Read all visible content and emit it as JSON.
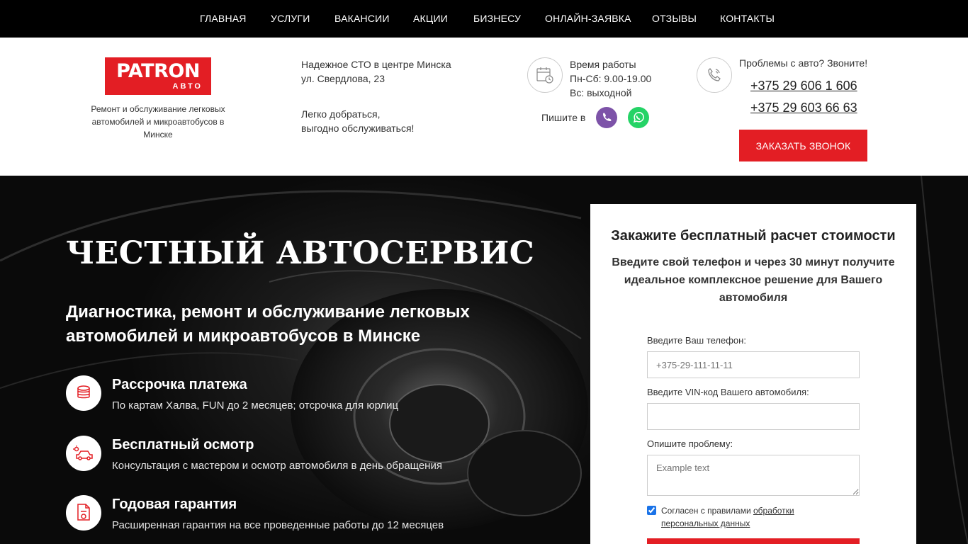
{
  "nav": {
    "items": [
      "ГЛАВНАЯ",
      "УСЛУГИ",
      "ВАКАНСИИ",
      "АКЦИИ",
      "БИЗНЕСУ",
      "ОНЛАЙН-ЗАЯВКА",
      "ОТЗЫВЫ",
      "КОНТАКТЫ"
    ]
  },
  "header": {
    "logo_top": "PATRON",
    "logo_bottom": "АВТО",
    "logo_desc": "Ремонт и обслуживание легковых автомобилей и микроавтобусов в Минске",
    "address_line1": "Надежное СТО в центре Минска",
    "address_line2": "ул. Свердлова, 23",
    "easy_line1": "Легко добраться,",
    "easy_line2": "выгодно обслуживаться!",
    "hours_title": "Время работы",
    "hours_weekdays": "Пн-Сб: 9.00-19.00",
    "hours_sunday": "Вс: выходной",
    "write_label": "Пишите в",
    "call_prompt": "Проблемы с авто? Звоните!",
    "phone1": "+375 29 606 1 606",
    "phone2": "+375 29 603 66 63",
    "callback_button": "ЗАКАЗАТЬ ЗВОНОК"
  },
  "hero": {
    "title": "ЧЕСТНЫЙ АВТОСЕРВИС",
    "subtitle": "Диагностика, ремонт и обслуживание легковых автомобилей и микроавтобусов в Минске",
    "features": [
      {
        "icon": "coins-icon",
        "title": "Рассрочка платежа",
        "desc": "По картам Халва, FUN до 2 месяцев; отсрочка для юрлиц"
      },
      {
        "icon": "car-inspection-icon",
        "title": "Бесплатный осмотр",
        "desc": "Консультация с мастером и осмотр автомобиля в день обращения"
      },
      {
        "icon": "warranty-document-icon",
        "title": "Годовая гарантия",
        "desc": "Расширенная гарантия на все проведенные работы до 12 месяцев"
      }
    ]
  },
  "form": {
    "title": "Закажите бесплатный расчет стоимости",
    "lead": "Введите свой телефон и через 30 минут получите идеальное комплексное решение для Вашего автомобиля",
    "phone_label": "Введите Ваш телефон:",
    "phone_placeholder": "+375-29-111-11-11",
    "vin_label": "Введите VIN-код Вашего автомобиля:",
    "vin_placeholder": "",
    "problem_label": "Опишите проблему:",
    "problem_placeholder": "Example text",
    "agree_text": "Согласен с правилами ",
    "agree_link": "обработки персональных данных",
    "agree_checked": true
  },
  "colors": {
    "brand_red": "#e31e24",
    "nav_bg": "#000000",
    "viber": "#7d53a8",
    "whatsapp": "#25d366"
  }
}
